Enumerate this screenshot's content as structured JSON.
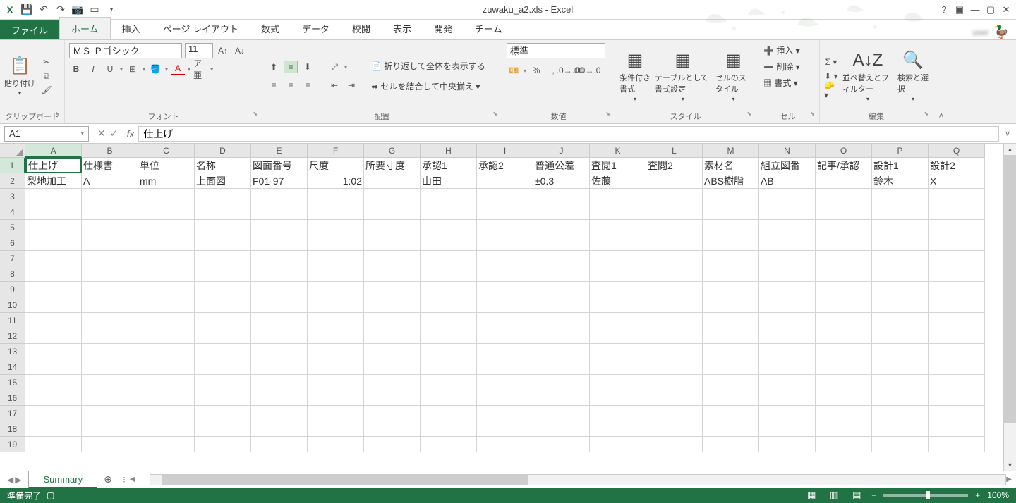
{
  "title": "zuwaku_a2.xls - Excel",
  "qat": [
    "save-icon",
    "undo-icon",
    "redo-icon",
    "camera-icon",
    "new-icon"
  ],
  "tabs": {
    "file": "ファイル",
    "home": "ホーム",
    "insert": "挿入",
    "pagelayout": "ページ レイアウト",
    "formulas": "数式",
    "data": "データ",
    "review": "校閲",
    "view": "表示",
    "developer": "開発",
    "team": "チーム"
  },
  "ribbon": {
    "clipboard": {
      "paste": "貼り付け",
      "label": "クリップボード"
    },
    "font": {
      "name": "ＭＳ Ｐゴシック",
      "size": "11",
      "label": "フォント"
    },
    "alignment": {
      "wrap": "折り返して全体を表示する",
      "merge": "セルを結合して中央揃え",
      "label": "配置"
    },
    "number": {
      "format": "標準",
      "label": "数値"
    },
    "styles": {
      "cond": "条件付き書式",
      "table": "テーブルとして書式設定",
      "cell": "セルのスタイル",
      "label": "スタイル"
    },
    "cells": {
      "insert": "挿入",
      "delete": "削除",
      "format": "書式",
      "label": "セル"
    },
    "editing": {
      "sort": "並べ替えとフィルター",
      "find": "検索と選択",
      "label": "編集"
    }
  },
  "namebox": "A1",
  "formula": "仕上げ",
  "columns": [
    "A",
    "B",
    "C",
    "D",
    "E",
    "F",
    "G",
    "H",
    "I",
    "J",
    "K",
    "L",
    "M",
    "N",
    "O",
    "P",
    "Q"
  ],
  "row_numbers": [
    1,
    2,
    3,
    4,
    5,
    6,
    7,
    8,
    9,
    10,
    11,
    12,
    13,
    14,
    15,
    16,
    17,
    18,
    19
  ],
  "sheet_data": {
    "1": {
      "A": "仕上げ",
      "B": "仕様書",
      "C": "単位",
      "D": "名称",
      "E": "図面番号",
      "F": "尺度",
      "G": "所要寸度",
      "H": "承認1",
      "I": "承認2",
      "J": "普通公差",
      "K": "査閲1",
      "L": "査閲2",
      "M": "素材名",
      "N": "組立図番",
      "O": "記事/承認",
      "P": "設計1",
      "Q": "設計2"
    },
    "2": {
      "A": "梨地加工",
      "B": "A",
      "C": "mm",
      "D": "上面図",
      "E": "F01-97",
      "F": "1:02",
      "G": "",
      "H": "山田",
      "I": "",
      "J": "±0.3",
      "K": "佐藤",
      "L": "",
      "M": "ABS樹脂",
      "N": "AB",
      "O": "",
      "P": "鈴木",
      "Q": "X"
    }
  },
  "active_cell": "A1",
  "sheet_name": "Summary",
  "status": {
    "ready": "準備完了",
    "zoom": "100%"
  }
}
